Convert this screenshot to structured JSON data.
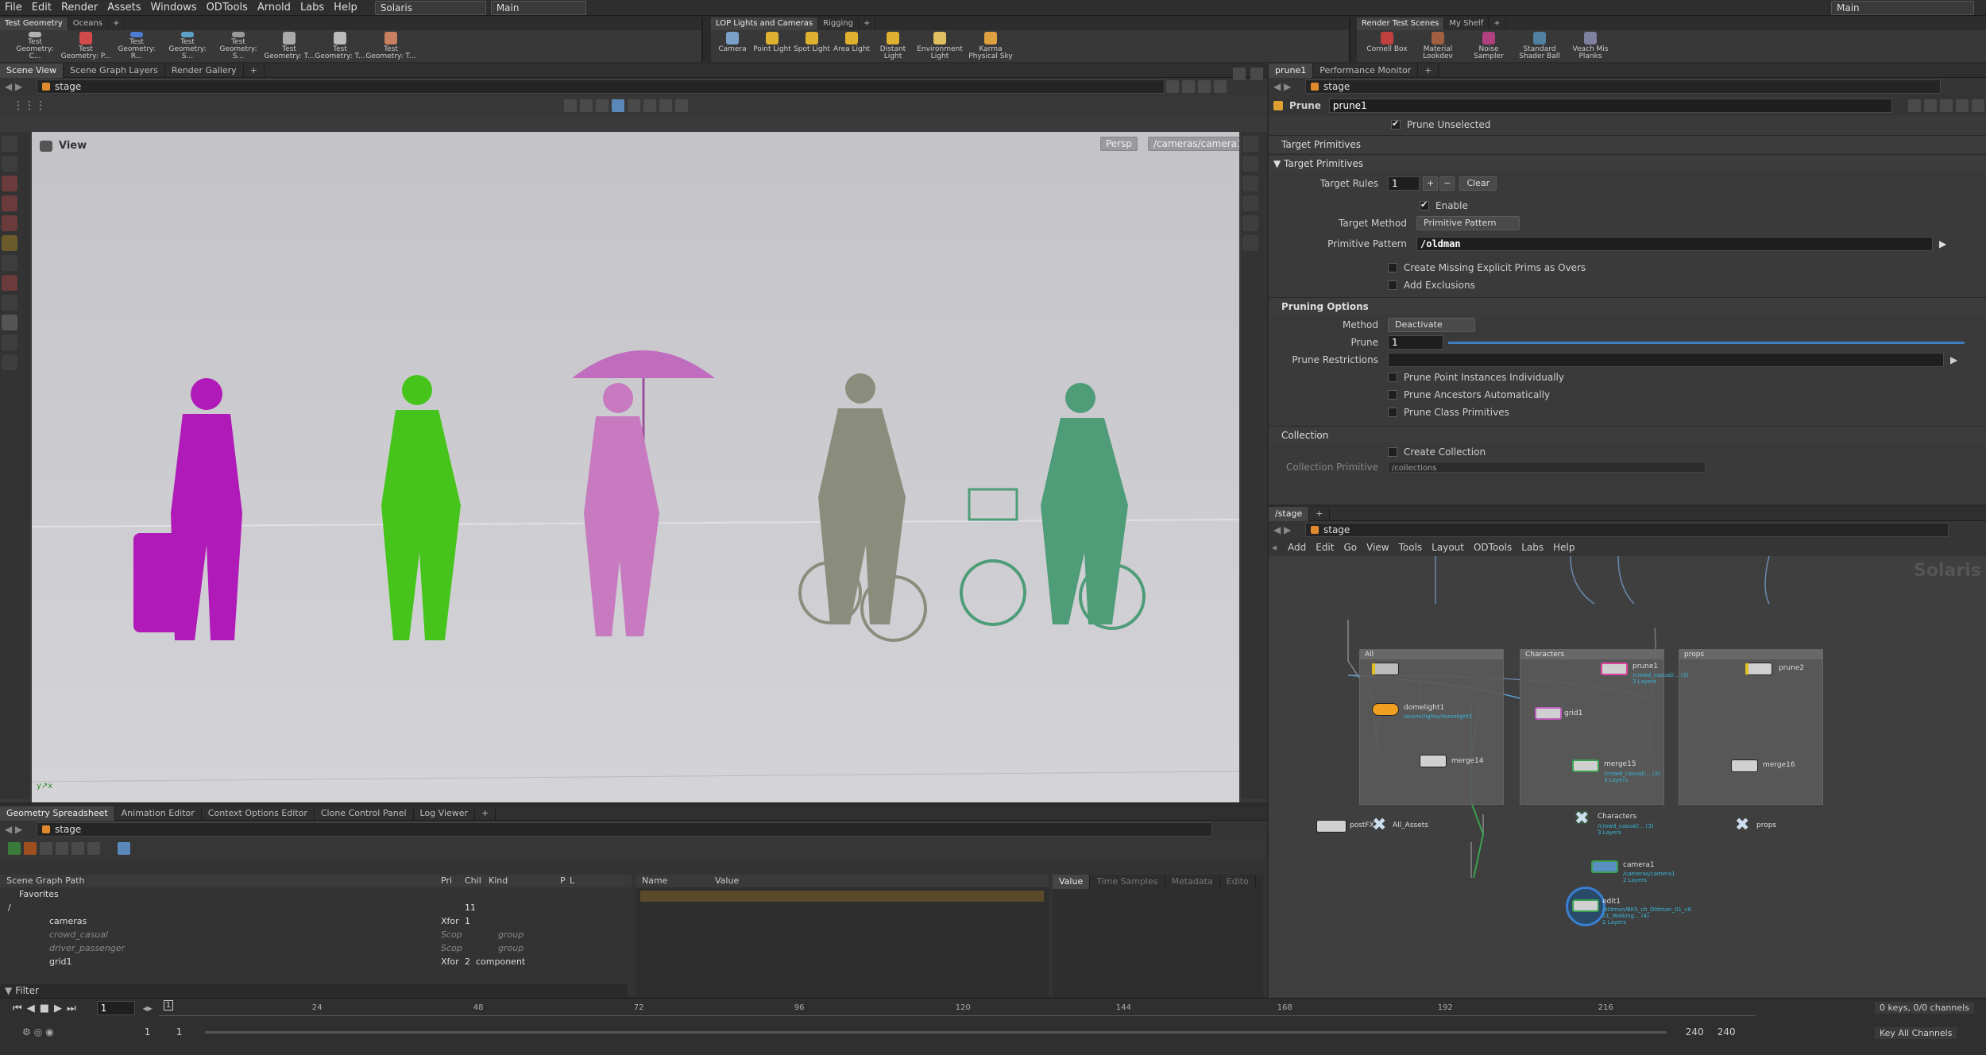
{
  "menu": {
    "items": [
      "File",
      "Edit",
      "Render",
      "Assets",
      "Windows",
      "ODTools",
      "Arnold",
      "Labs",
      "Help"
    ],
    "desktop": "Solaris",
    "context": "Main",
    "right_desktop": "Main"
  },
  "shelf1": {
    "tabs": [
      "Test Geometry",
      "Oceans"
    ],
    "tools": [
      "Test Geometry: C...",
      "Test Geometry: P...",
      "Test Geometry: R...",
      "Test Geometry: S...",
      "Test Geometry: S...",
      "Test Geometry: T...",
      "Test Geometry: T...",
      "Test Geometry: T..."
    ]
  },
  "shelf2": {
    "tabs": [
      "LOP Lights and Cameras",
      "Rigging"
    ],
    "tools": [
      "Camera",
      "Point Light",
      "Spot Light",
      "Area Light",
      "Distant Light",
      "Environment Light",
      "Karma Physical Sky"
    ]
  },
  "shelf3": {
    "tabs": [
      "Render Test Scenes",
      "My Shelf"
    ],
    "tools": [
      "Cornell Box",
      "Material Lookdev",
      "Noise Sampler",
      "Standard Shader Ball",
      "Veach Mis Planks"
    ]
  },
  "scene_view": {
    "tabs": [
      "Scene View",
      "Scene Graph Layers",
      "Render Gallery"
    ],
    "path": "stage",
    "view_label": "View",
    "persp": "Persp",
    "camera": "/cameras/camera1"
  },
  "params": {
    "tabs": [
      "prune1",
      "Performance Monitor"
    ],
    "path": "stage",
    "node_type": "Prune",
    "node_name": "prune1",
    "prune_unselected": "Prune Unselected",
    "target_header": "Target Primitives",
    "target_section": "Target Primitives",
    "target_rules_label": "Target Rules",
    "target_rules_value": "1",
    "clear": "Clear",
    "enable": "Enable",
    "target_method_label": "Target Method",
    "target_method": "Primitive Pattern",
    "prim_pattern_label": "Primitive Pattern",
    "prim_pattern": "/oldman",
    "create_missing": "Create Missing Explicit Prims as Overs",
    "add_exclusions": "Add Exclusions",
    "pruning_section": "Pruning Options",
    "method_label": "Method",
    "method": "Deactivate",
    "prune_label": "Prune",
    "prune_value": "1",
    "prune_restrictions": "Prune Restrictions",
    "prune_points": "Prune Point Instances Individually",
    "prune_ancestors": "Prune Ancestors Automatically",
    "prune_class": "Prune Class Primitives",
    "collection_section": "Collection",
    "create_collection": "Create Collection",
    "collection_prim": "Collection Primitive",
    "collection_prim_value": "/collections"
  },
  "network": {
    "tabs": [
      "/stage"
    ],
    "path": "stage",
    "menu": [
      "Add",
      "Edit",
      "Go",
      "View",
      "Tools",
      "Layout",
      "ODTools",
      "Labs",
      "Help"
    ],
    "watermark": "Solaris",
    "boxes": [
      {
        "title": "All"
      },
      {
        "title": "Characters"
      },
      {
        "title": "props"
      }
    ],
    "nodes": {
      "domelight": "domelight1",
      "domelight_sub": "/scene/lights/domelight1",
      "merge14": "merge14",
      "grid": "grid1",
      "prune1": "prune1",
      "prune1_sub": "/crowd_casual/... (3)",
      "prune1_sub2": "3 Layers",
      "merge15": "merge15",
      "merge15_sub": "/crowd_casual/... (3)",
      "merge15_sub2": "3 Layers",
      "prune2": "prune2",
      "merge16": "merge16",
      "postfx": "postFX",
      "all_assets": "All_Assets",
      "characters": "Characters",
      "characters_sub": "/crowd_casual/... (3)",
      "characters_sub2": "3 Layers",
      "props": "props",
      "camera": "camera1",
      "camera_sub": "/cameras/camera1",
      "camera_sub2": "2 Layers",
      "last": "edit1",
      "last_sub": "/oldman/BKS_ch_Oldman_01_v0",
      "last_sub2": "01_Walking... (4)",
      "last_sub3": "2 Layers"
    }
  },
  "spreadsheet": {
    "tabs": [
      "Geometry Spreadsheet",
      "Animation Editor",
      "Context Options Editor",
      "Clone Control Panel",
      "Log Viewer"
    ],
    "path": "stage",
    "cols": [
      "Scene Graph Path",
      "Pri",
      "Chil",
      "Kind",
      "P",
      "L"
    ],
    "rows": [
      {
        "name": "Favorites",
        "pri": "",
        "chil": "",
        "kind": ""
      },
      {
        "name": "/",
        "pri": "",
        "chil": "11",
        "kind": ""
      },
      {
        "name": "cameras",
        "pri": "Xfor",
        "chil": "1",
        "kind": ""
      },
      {
        "name": "crowd_casual",
        "pri": "Scop",
        "chil": "",
        "kind": "group"
      },
      {
        "name": "driver_passenger",
        "pri": "Scop",
        "chil": "",
        "kind": "group"
      },
      {
        "name": "grid1",
        "pri": "Xfor",
        "chil": "2",
        "kind": "component"
      }
    ],
    "filter": "Filter",
    "name_col": "Name",
    "value_col": "Value",
    "right_tabs": [
      "Value",
      "Time Samples",
      "Metadata",
      "Edito"
    ]
  },
  "timeline": {
    "frame": "1",
    "ticks": [
      "24",
      "48",
      "72",
      "96",
      "120",
      "144",
      "168",
      "192",
      "216"
    ],
    "start": "1",
    "start2": "1",
    "end": "240",
    "end2": "240",
    "keys": "0 keys, 0/0 channels",
    "key_all": "Key All Channels"
  }
}
